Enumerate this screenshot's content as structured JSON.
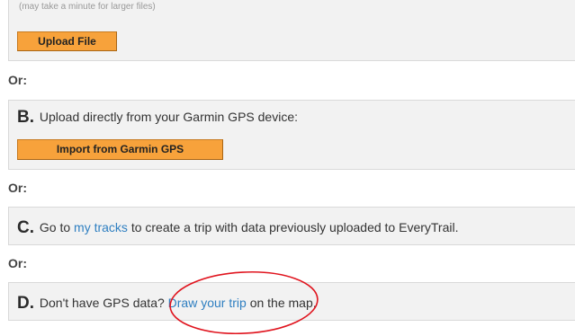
{
  "section_a": {
    "note": "(may take a minute for larger files)",
    "upload_button": "Upload File"
  },
  "or_label": "Or:",
  "section_b": {
    "letter": "B.",
    "text": "Upload directly from your Garmin GPS device:",
    "import_button": "Import from Garmin GPS"
  },
  "section_c": {
    "letter": "C.",
    "text_before": "Go to",
    "link": "my tracks",
    "text_after": "to create a trip with data previously uploaded to EveryTrail."
  },
  "section_d": {
    "letter": "D.",
    "text_before": "Don't have GPS data?",
    "link": "Draw your trip",
    "text_after": "on the map."
  },
  "colors": {
    "button_orange": "#f7a23b",
    "link_blue": "#2f7fc1",
    "annotation_red": "#e0141e",
    "box_bg": "#f2f2f2"
  }
}
